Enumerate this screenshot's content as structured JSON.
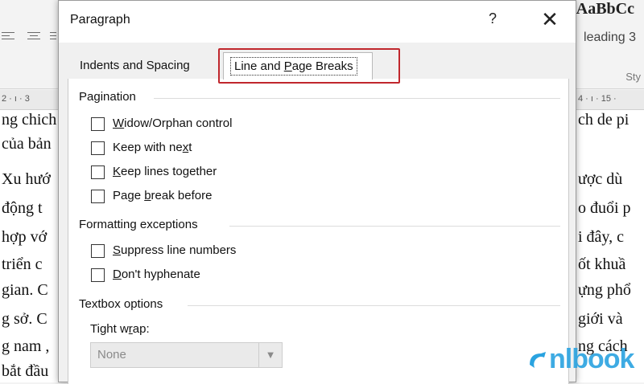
{
  "background": {
    "style_preview": "AaBbCc",
    "heading_style": "leading 3",
    "styles_label": "Sty",
    "ruler_left": "2 · ı · 3",
    "ruler_right": "4 · ı · 15 ·",
    "doc_left_lines": [
      "ng chich",
      "của bản",
      "Xu hướ",
      "động t",
      "hợp vớ",
      "triển c",
      "gian. C",
      "g sở. C",
      "g nam ,",
      "bắt đầu"
    ],
    "doc_right_lines": [
      "ch de pi",
      "",
      "ược dù",
      "o đuổi p",
      "i đây, c",
      "ốt khuầ",
      "ựng phổ",
      "giới và",
      "ng cách",
      ""
    ]
  },
  "dialog": {
    "title": "Paragraph",
    "help_label": "?",
    "close_label": "✕",
    "tabs": [
      {
        "label": "Indents and Spacing",
        "active": false
      },
      {
        "label": "Line and Page Breaks",
        "active": true
      }
    ],
    "sections": {
      "pagination": {
        "title": "Pagination",
        "options": [
          {
            "label": "Widow/Orphan control",
            "checked": false
          },
          {
            "label": "Keep with next",
            "checked": false
          },
          {
            "label": "Keep lines together",
            "checked": false
          },
          {
            "label": "Page break before",
            "checked": false
          }
        ]
      },
      "formatting": {
        "title": "Formatting exceptions",
        "options": [
          {
            "label": "Suppress line numbers",
            "checked": false
          },
          {
            "label": "Don't hyphenate",
            "checked": false
          }
        ]
      },
      "textbox": {
        "title": "Textbox options",
        "tight_wrap_label": "Tight wrap:",
        "tight_wrap_value": "None"
      }
    }
  },
  "watermark": {
    "text": "nlbook",
    "color": "#2aa3e0"
  },
  "colors": {
    "highlight": "#c0272d"
  }
}
